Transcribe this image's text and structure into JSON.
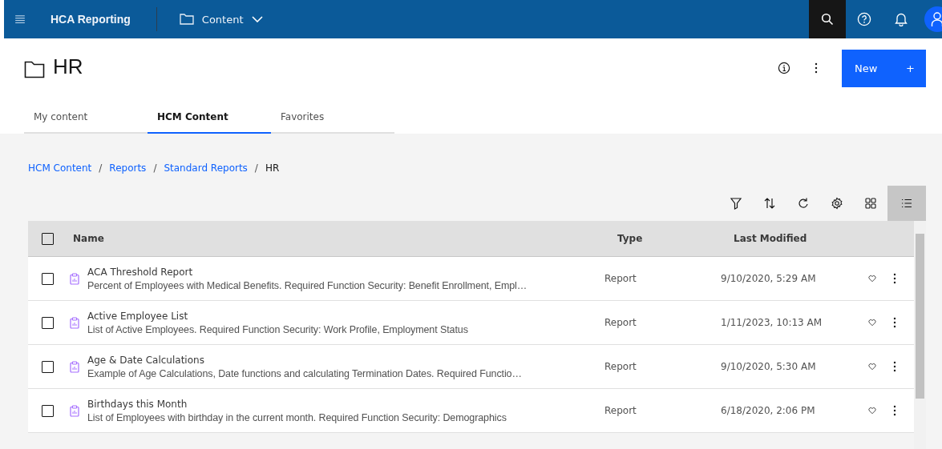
{
  "topbar": {
    "product": "HCA Reporting",
    "location": "Content"
  },
  "page": {
    "title": "HR",
    "new_button": "New",
    "new_plus": "+"
  },
  "tabs": [
    {
      "label": "My content",
      "selected": false
    },
    {
      "label": "HCM Content",
      "selected": true
    },
    {
      "label": "Favorites",
      "selected": false
    }
  ],
  "breadcrumbs": [
    {
      "label": "HCM Content",
      "kind": "link"
    },
    {
      "label": "Reports",
      "kind": "link"
    },
    {
      "label": "Standard Reports",
      "kind": "link"
    },
    {
      "label": "HR",
      "kind": "current"
    }
  ],
  "breadcrumb_separator": "/",
  "toolbar": [
    {
      "kind": "filter",
      "selected": false
    },
    {
      "kind": "sort",
      "selected": false
    },
    {
      "kind": "refresh",
      "selected": false
    },
    {
      "kind": "settings",
      "selected": false
    },
    {
      "kind": "grid",
      "selected": false
    },
    {
      "kind": "list",
      "selected": true
    }
  ],
  "table": {
    "columns": [
      "Name",
      "Type",
      "Last Modified"
    ],
    "all_checked": false,
    "rows": [
      {
        "name": "ACA Threshold Report",
        "description": "Percent of Employees with Medical Benefits. Required Function Security: Benefit Enrollment, Empl…",
        "type": "Report",
        "modified": "9/10/2020, 5:29 AM",
        "checked": false,
        "favorite": false
      },
      {
        "name": "Active Employee List",
        "description": "List of Active Employees. Required Function Security: Work Profile, Employment Status",
        "type": "Report",
        "modified": "1/11/2023, 10:13 AM",
        "checked": false,
        "favorite": false
      },
      {
        "name": "Age & Date Calculations",
        "description": "Example of Age Calculations, Date functions and calculating Termination Dates. Required Functio…",
        "type": "Report",
        "modified": "9/10/2020, 5:30 AM",
        "checked": false,
        "favorite": false
      },
      {
        "name": "Birthdays this Month",
        "description": "List of Employees with birthday in the current month. Required Function Security: Demographics",
        "type": "Report",
        "modified": "6/18/2020, 2:06 PM",
        "checked": false,
        "favorite": false
      }
    ]
  }
}
